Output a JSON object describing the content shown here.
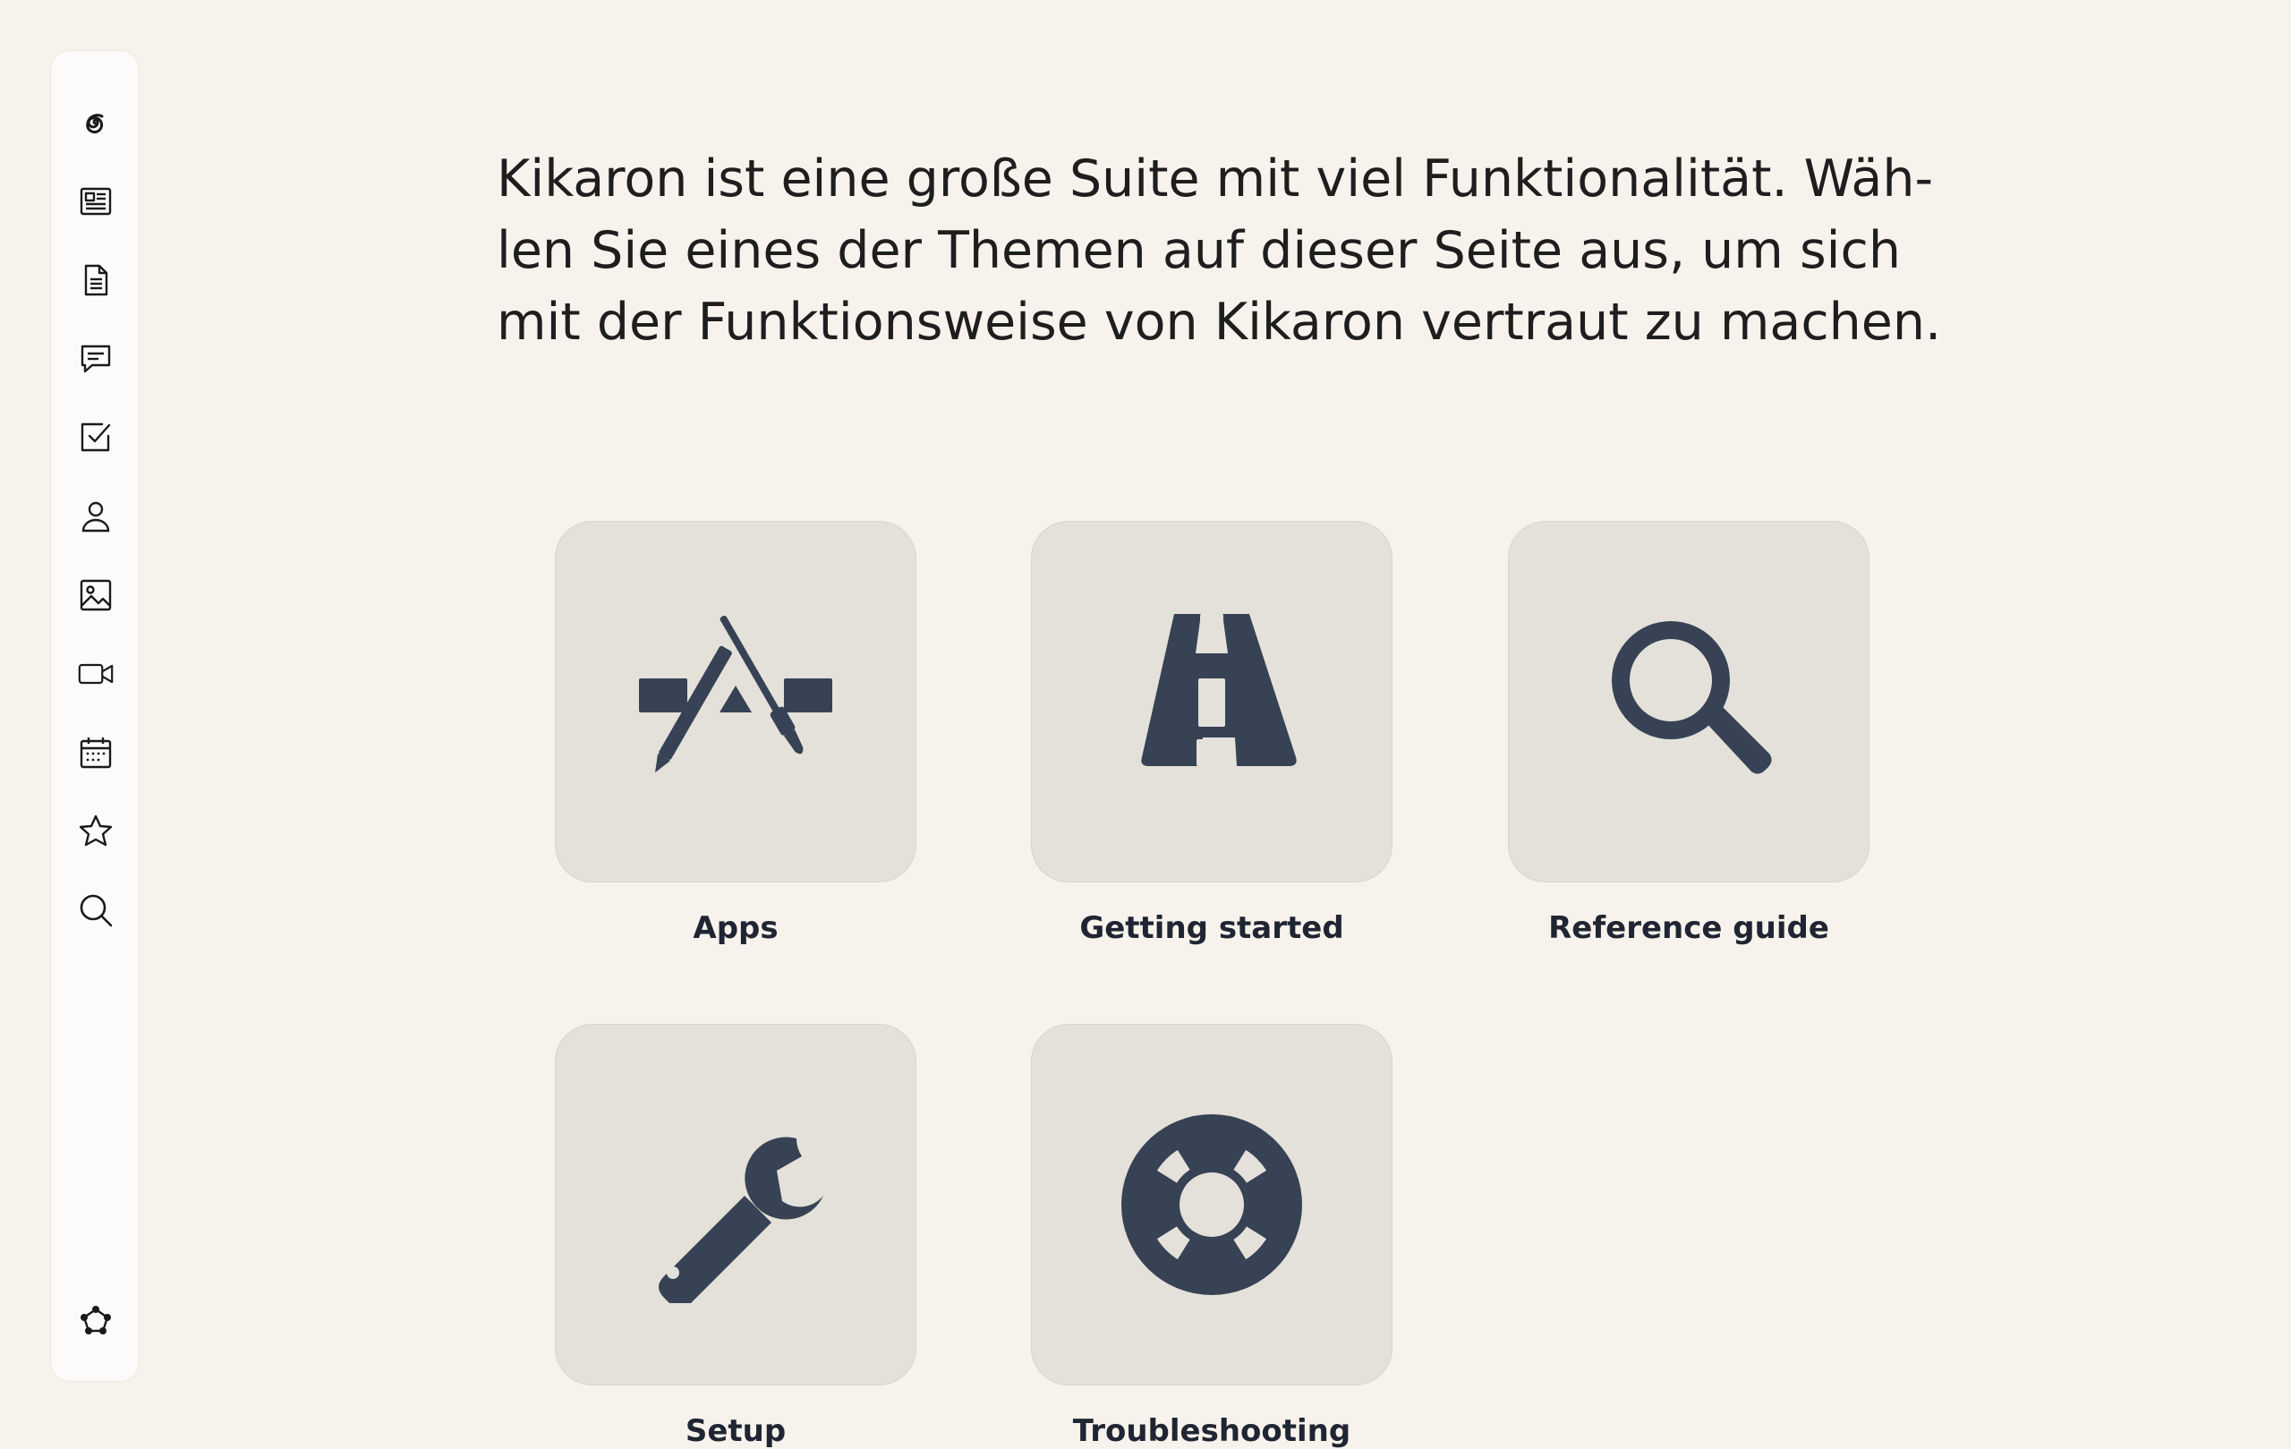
{
  "sidebar": {
    "items": [
      {
        "icon": "spiral-logo-icon"
      },
      {
        "icon": "newspaper-icon"
      },
      {
        "icon": "document-icon"
      },
      {
        "icon": "chat-icon"
      },
      {
        "icon": "checkbox-icon"
      },
      {
        "icon": "person-icon"
      },
      {
        "icon": "image-icon"
      },
      {
        "icon": "video-camera-icon"
      },
      {
        "icon": "calendar-icon"
      },
      {
        "icon": "star-icon"
      },
      {
        "icon": "search-icon"
      }
    ],
    "bottom_icon": "pentagon-network-icon"
  },
  "intro": {
    "line1": "Kikaron ist eine große Suite mit viel Funktionalität. Wäh-",
    "line2": "len Sie eines der Themen auf dieser Seite aus, um sich",
    "line3": "mit der Funktionsweise von Kikaron vertraut zu machen."
  },
  "topics": [
    {
      "label": "Apps",
      "icon": "app-store-icon"
    },
    {
      "label": "Getting started",
      "icon": "road-icon"
    },
    {
      "label": "Reference guide",
      "icon": "magnifier-icon"
    },
    {
      "label": "Setup",
      "icon": "wrench-icon"
    },
    {
      "label": "Troubleshooting",
      "icon": "lifebuoy-icon"
    }
  ],
  "colors": {
    "background": "#f7f2ec",
    "tile": "#e4e1da",
    "icon": "#374254"
  }
}
